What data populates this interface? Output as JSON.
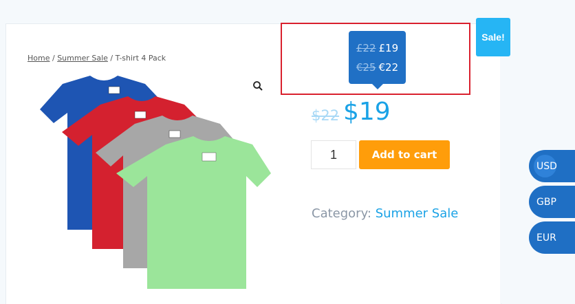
{
  "breadcrumb": {
    "home": "Home",
    "sep1": " / ",
    "category": "Summer Sale",
    "sep2": " / ",
    "current": "T-shirt 4 Pack"
  },
  "tooltip": {
    "gbp_old": "£22",
    "gbp_new": "£19",
    "eur_old": "€25",
    "eur_new": "€22"
  },
  "sale_badge": "Sale!",
  "price": {
    "old": "$22",
    "new": "$19"
  },
  "quantity": "1",
  "add_to_cart": "Add to cart",
  "category": {
    "label": "Category: ",
    "value": "Summer Sale"
  },
  "currencies": [
    "USD",
    "GBP",
    "EUR"
  ],
  "icons": {
    "zoom": "magnifier-icon"
  },
  "colors": {
    "accent": "#1aa2e6",
    "add_button": "#ff9d0a",
    "sale_badge": "#26b5f4",
    "tooltip": "#2070c5",
    "currency_button": "#1f6fc4",
    "highlight": "#d9202d"
  }
}
